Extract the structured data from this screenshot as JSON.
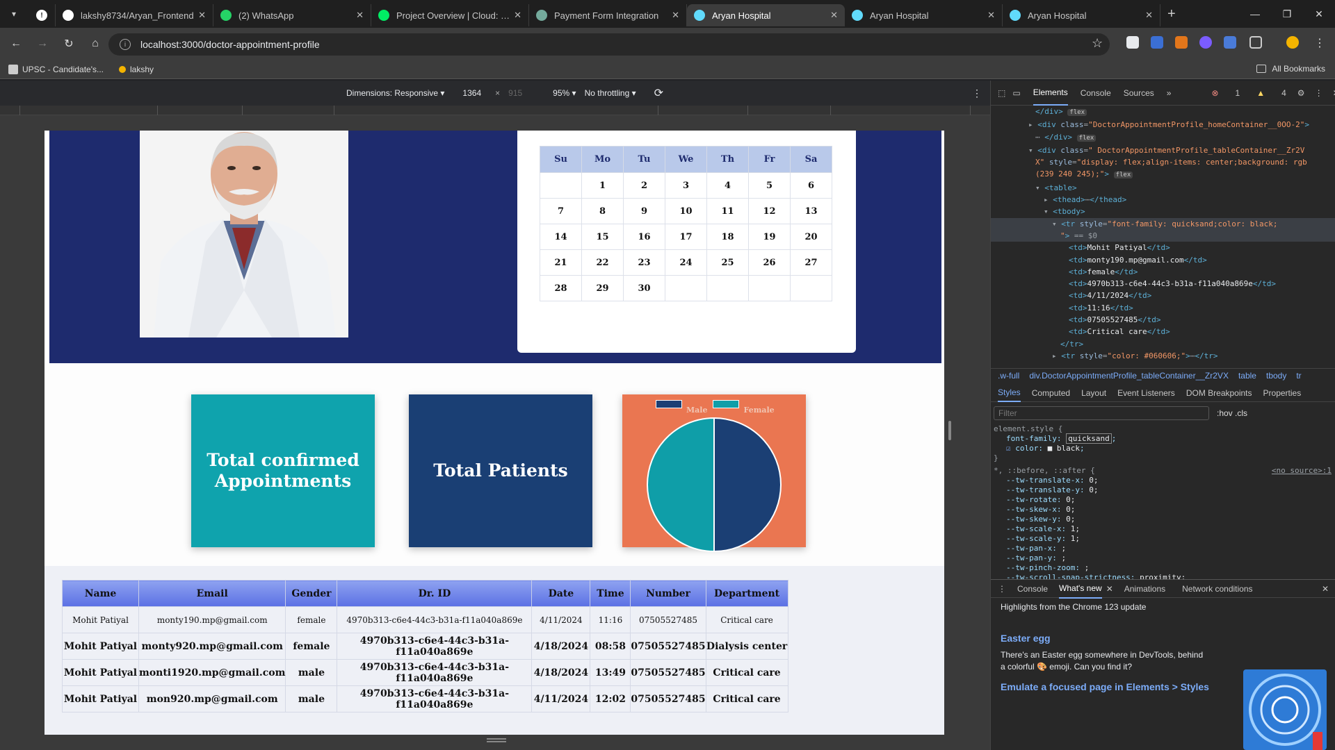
{
  "browser": {
    "tabs": [
      {
        "title": "lakshy8734/Aryan_Frontend",
        "icon": "github-icon",
        "color": "#ffffff"
      },
      {
        "title": "(2) WhatsApp",
        "icon": "whatsapp-icon",
        "color": "#25d366"
      },
      {
        "title": "Project Overview | Cloud: Mor",
        "icon": "mongodb-icon",
        "color": "#00ed64"
      },
      {
        "title": "Payment Form Integration",
        "icon": "chatgpt-icon",
        "color": "#74aa9c"
      },
      {
        "title": "Aryan Hospital",
        "icon": "react-icon",
        "color": "#61dafb",
        "active": true
      },
      {
        "title": "Aryan Hospital",
        "icon": "react-icon",
        "color": "#61dafb"
      },
      {
        "title": "Aryan Hospital",
        "icon": "react-icon",
        "color": "#61dafb"
      }
    ],
    "url": "localhost:3000/doctor-appointment-profile",
    "bookmarks": [
      {
        "label": "UPSC - Candidate's..."
      },
      {
        "label": "lakshy"
      }
    ],
    "all_bookmarks": "All Bookmarks"
  },
  "device_toolbar": {
    "dimensions_label": "Dimensions: Responsive",
    "width": "1364",
    "times": "×",
    "height": "915",
    "zoom": "95%",
    "throttling": "No throttling"
  },
  "calendar": {
    "days": [
      "Su",
      "Mo",
      "Tu",
      "We",
      "Th",
      "Fr",
      "Sa"
    ],
    "weeks": [
      [
        "",
        "1",
        "2",
        "3",
        "4",
        "5",
        "6"
      ],
      [
        "7",
        "8",
        "9",
        "10",
        "11",
        "12",
        "13"
      ],
      [
        "14",
        "15",
        "16",
        "17",
        "18",
        "19",
        "20"
      ],
      [
        "21",
        "22",
        "23",
        "24",
        "25",
        "26",
        "27"
      ],
      [
        "28",
        "29",
        "30",
        "",
        "",
        "",
        ""
      ]
    ]
  },
  "cards": {
    "confirmed": "Total confirmed Appointments",
    "patients": "Total Patients"
  },
  "chart_data": {
    "type": "pie",
    "labels": [
      "Male",
      "Female"
    ],
    "values": [
      50,
      50
    ],
    "colors": [
      "#1b3f74",
      "#0f9ea8"
    ]
  },
  "table": {
    "headers": [
      "Name",
      "Email",
      "Gender",
      "Dr. ID",
      "Date",
      "Time",
      "Number",
      "Department"
    ],
    "rows": [
      [
        "Mohit Patiyal",
        "monty190.mp@gmail.com",
        "female",
        "4970b313-c6e4-44c3-b31a-f11a040a869e",
        "4/11/2024",
        "11:16",
        "07505527485",
        "Critical care"
      ],
      [
        "Mohit Patiyal",
        "monty920.mp@gmail.com",
        "female",
        "4970b313-c6e4-44c3-b31a-f11a040a869e",
        "4/18/2024",
        "08:58",
        "07505527485",
        "Dialysis center"
      ],
      [
        "Mohit Patiyal",
        "monti1920.mp@gmail.com",
        "male",
        "4970b313-c6e4-44c3-b31a-f11a040a869e",
        "4/18/2024",
        "13:49",
        "07505527485",
        "Critical care"
      ],
      [
        "Mohit Patiyal",
        "mon920.mp@gmail.com",
        "male",
        "4970b313-c6e4-44c3-b31a-f11a040a869e",
        "4/11/2024",
        "12:02",
        "07505527485",
        "Critical care"
      ]
    ]
  },
  "devtools": {
    "tabs": [
      "Elements",
      "Console",
      "Sources"
    ],
    "errors": "1",
    "warnings": "4",
    "breadcrumbs": [
      ".w-full",
      "div.DoctorAppointmentProfile_tableContainer__Zr2VX",
      "table",
      "tbody",
      "tr"
    ],
    "style_tabs": [
      "Styles",
      "Computed",
      "Layout",
      "Event Listeners",
      "DOM Breakpoints",
      "Properties"
    ],
    "filter_placeholder": "Filter",
    "filter_buttons": ":hov  .cls",
    "drawer_tabs": [
      "Console",
      "What's new",
      "Animations",
      "Network conditions"
    ],
    "whats_new": {
      "heading": "Highlights from the Chrome 123 update",
      "title": "Easter egg",
      "text": "There's an Easter egg somewhere in DevTools, behind a colorful 🎨 emoji. Can you find it?",
      "link": "Emulate a focused page in Elements > Styles"
    }
  }
}
